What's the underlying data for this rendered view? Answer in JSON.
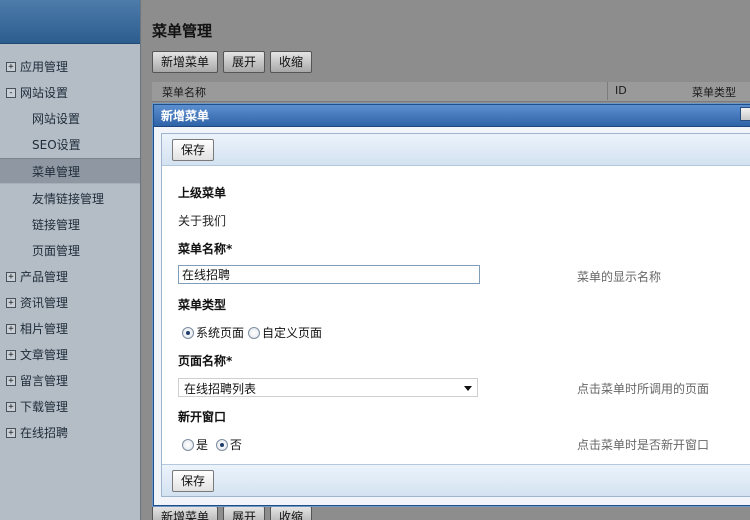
{
  "sidebar": {
    "items": [
      {
        "label": "应用管理",
        "toggle": "+",
        "level": "top"
      },
      {
        "label": "网站设置",
        "toggle": "-",
        "level": "top"
      },
      {
        "label": "网站设置",
        "level": "sub"
      },
      {
        "label": "SEO设置",
        "level": "sub"
      },
      {
        "label": "菜单管理",
        "level": "sub",
        "active": true
      },
      {
        "label": "友情链接管理",
        "level": "sub"
      },
      {
        "label": "链接管理",
        "level": "sub"
      },
      {
        "label": "页面管理",
        "level": "sub"
      },
      {
        "label": "产品管理",
        "toggle": "+",
        "level": "top"
      },
      {
        "label": "资讯管理",
        "toggle": "+",
        "level": "top"
      },
      {
        "label": "相片管理",
        "toggle": "+",
        "level": "top"
      },
      {
        "label": "文章管理",
        "toggle": "+",
        "level": "top"
      },
      {
        "label": "留言管理",
        "toggle": "+",
        "level": "top"
      },
      {
        "label": "下载管理",
        "toggle": "+",
        "level": "top"
      },
      {
        "label": "在线招聘",
        "toggle": "+",
        "level": "top"
      }
    ]
  },
  "main": {
    "title": "菜单管理",
    "toolbar": {
      "add": "新增菜单",
      "expand": "展开",
      "collapse": "收缩"
    },
    "table": {
      "col_name": "菜单名称",
      "col_id": "ID",
      "col_type": "菜单类型"
    }
  },
  "dialog": {
    "title": "新增菜单",
    "save_label": "保存",
    "fields": {
      "parent": {
        "label": "上级菜单",
        "value": "关于我们"
      },
      "name": {
        "label": "菜单名称*",
        "value": "在线招聘",
        "hint": "菜单的显示名称"
      },
      "type": {
        "label": "菜单类型",
        "options": [
          "系统页面",
          "自定义页面"
        ],
        "selected": "系统页面"
      },
      "page": {
        "label": "页面名称*",
        "value": "在线招聘列表",
        "hint": "点击菜单时所调用的页面"
      },
      "new_window": {
        "label": "新开窗口",
        "options": [
          "是",
          "否"
        ],
        "selected": "否",
        "hint": "点击菜单时是否新开窗口"
      }
    }
  },
  "colors": {
    "title_bar": "#2f63a7",
    "sidebar_bg": "#b4bcc5",
    "backdrop": "#8d8d8d"
  }
}
